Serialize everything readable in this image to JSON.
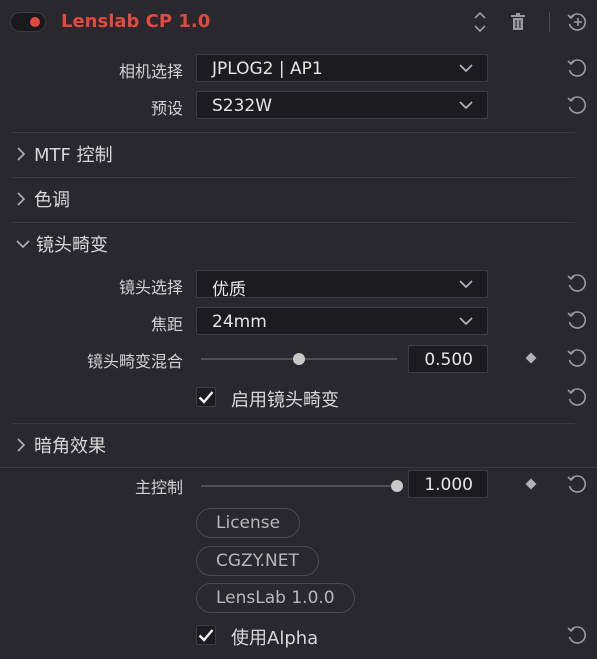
{
  "header": {
    "title": "Lenslab CP 1.0",
    "accent_color": "#e5483e",
    "icons": [
      "toggle-switch",
      "expand-collapse-icon",
      "trash-icon",
      "add-reset-icon"
    ]
  },
  "camera": {
    "label": "相机选择",
    "value": "JPLOG2 | AP1"
  },
  "preset": {
    "label": "预设",
    "value": "S232W"
  },
  "sections": {
    "mtf": "MTF 控制",
    "tone": "色调",
    "distortion": "镜头畸变",
    "vignette": "暗角效果"
  },
  "distortion": {
    "lens": {
      "label": "镜头选择",
      "value": "优质"
    },
    "focal": {
      "label": "焦距",
      "value": "24mm"
    },
    "mix": {
      "label": "镜头畸变混合",
      "value": "0.500",
      "level": 0.5
    },
    "enable": {
      "label": "启用镜头畸变",
      "checked": true
    }
  },
  "vignette": {
    "master": {
      "label": "主控制",
      "value": "1.000",
      "level": 1.0
    }
  },
  "buttons": {
    "license": "License",
    "site": "CGZY.NET",
    "version": "LensLab 1.0.0"
  },
  "alpha": {
    "label": "使用Alpha",
    "checked": true
  }
}
